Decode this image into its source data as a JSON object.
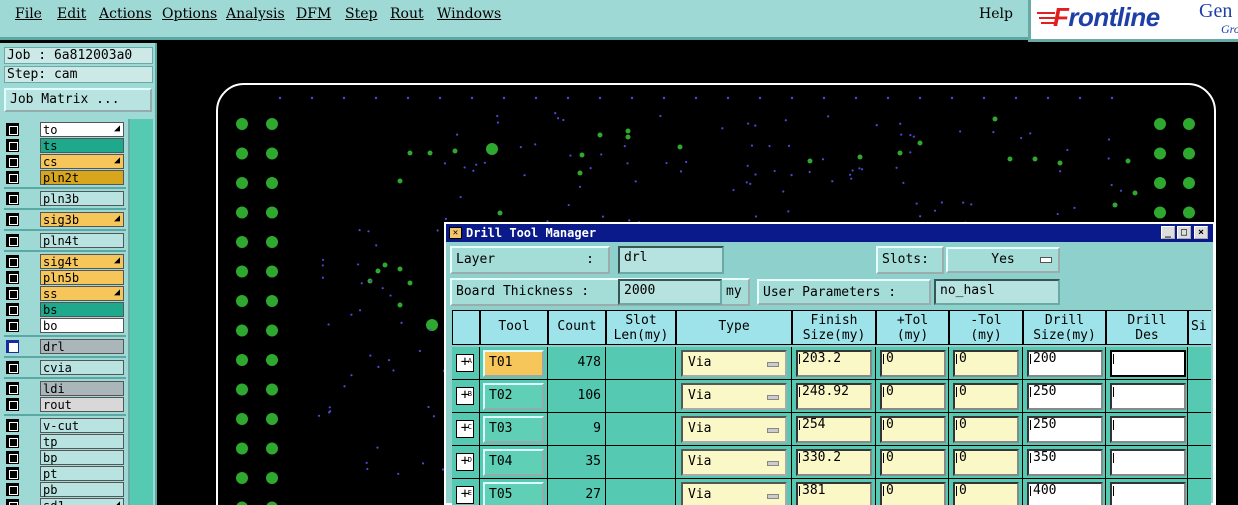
{
  "menu": {
    "items": [
      "File",
      "Edit",
      "Actions",
      "Options",
      "Analysis",
      "DFM",
      "Step",
      "Rout",
      "Windows"
    ],
    "help": "Help"
  },
  "brand": {
    "logo_f": "F",
    "logo_rest": "rontline",
    "extra": "Gen",
    "sub": "Gro"
  },
  "left": {
    "job": "Job : 6a812003a0",
    "step": "Step: cam",
    "job_matrix": "Job Matrix ...",
    "layers": [
      {
        "name": "to",
        "color": "#ffffff",
        "arrow": true,
        "checked": false
      },
      {
        "name": "ts",
        "color": "#1fa98c",
        "arrow": false,
        "checked": false
      },
      {
        "name": "cs",
        "color": "#f6c65a",
        "arrow": true,
        "checked": false
      },
      {
        "name": "pln2t",
        "color": "#d8a61c",
        "arrow": false,
        "checked": false
      },
      {
        "name": "pln3b",
        "color": "#b8e3e0",
        "arrow": false,
        "checked": false
      },
      {
        "name": "sig3b",
        "color": "#f6c65a",
        "arrow": true,
        "checked": false
      },
      {
        "name": "pln4t",
        "color": "#b8e3e0",
        "arrow": false,
        "checked": false
      },
      {
        "name": "sig4t",
        "color": "#f6c65a",
        "arrow": true,
        "checked": false
      },
      {
        "name": "pln5b",
        "color": "#f6c65a",
        "arrow": false,
        "checked": false
      },
      {
        "name": "ss",
        "color": "#f6c65a",
        "arrow": true,
        "checked": false
      },
      {
        "name": "bs",
        "color": "#1fa98c",
        "arrow": false,
        "checked": false
      },
      {
        "name": "bo",
        "color": "#ffffff",
        "arrow": false,
        "checked": false
      },
      {
        "name": "drl",
        "color": "#aab6ba",
        "arrow": false,
        "checked": true
      },
      {
        "name": "cvia",
        "color": "#b8e3e0",
        "arrow": false,
        "checked": false
      },
      {
        "name": "ldi",
        "color": "#aab6ba",
        "arrow": false,
        "checked": false
      },
      {
        "name": "rout",
        "color": "#d8d8d8",
        "arrow": false,
        "checked": false
      },
      {
        "name": "v-cut",
        "color": "#b8e3e0",
        "arrow": false,
        "checked": false
      },
      {
        "name": "tp",
        "color": "#b8e3e0",
        "arrow": false,
        "checked": false
      },
      {
        "name": "bp",
        "color": "#b8e3e0",
        "arrow": false,
        "checked": false
      },
      {
        "name": "pt",
        "color": "#b8e3e0",
        "arrow": false,
        "checked": false
      },
      {
        "name": "pb",
        "color": "#b8e3e0",
        "arrow": false,
        "checked": false
      },
      {
        "name": "sd1",
        "color": "#b8e3e0",
        "arrow": true,
        "checked": false
      }
    ]
  },
  "dtm": {
    "title": "Drill Tool Manager",
    "layer_label": "Layer",
    "layer_colon": ":",
    "layer_value": "drl",
    "slots_label": "Slots:",
    "slots_value": "Yes",
    "thickness_label": "Board Thickness :",
    "thickness_value": "2000",
    "thickness_unit": "my",
    "user_params_label": "User Parameters :",
    "user_params_value": "no_hasl",
    "columns": {
      "tool": "Tool",
      "count": "Count",
      "slot_len_1": "Slot",
      "slot_len_2": "Len(my)",
      "type": "Type",
      "finish_1": "Finish",
      "finish_2": "Size(my)",
      "ptol_1": "+Tol",
      "ptol_2": "(my)",
      "mtol_1": "-Tol",
      "mtol_2": "(my)",
      "drill_1": "Drill",
      "drill_2": "Size(my)",
      "des_1": "Drill",
      "des_2": "Des",
      "si": "Si"
    },
    "rows": [
      {
        "marker": "A",
        "tool": "T01",
        "count": "478",
        "type": "Via",
        "finish": "203.2",
        "ptol": "0",
        "mtol": "0",
        "drill": "200",
        "des": ""
      },
      {
        "marker": "B",
        "tool": "T02",
        "count": "106",
        "type": "Via",
        "finish": "248.92",
        "ptol": "0",
        "mtol": "0",
        "drill": "250",
        "des": ""
      },
      {
        "marker": "C",
        "tool": "T03",
        "count": "9",
        "type": "Via",
        "finish": "254",
        "ptol": "0",
        "mtol": "0",
        "drill": "250",
        "des": ""
      },
      {
        "marker": "D",
        "tool": "T04",
        "count": "35",
        "type": "Via",
        "finish": "330.2",
        "ptol": "0",
        "mtol": "0",
        "drill": "350",
        "des": ""
      },
      {
        "marker": "E",
        "tool": "T05",
        "count": "27",
        "type": "Via",
        "finish": "381",
        "ptol": "0",
        "mtol": "0",
        "drill": "400",
        "des": ""
      }
    ]
  },
  "colors": {
    "menubar": "#9fd9d6",
    "pad": "#2ea82e",
    "via": "#4b4bd6",
    "title_bar": "#0a1a8a"
  }
}
